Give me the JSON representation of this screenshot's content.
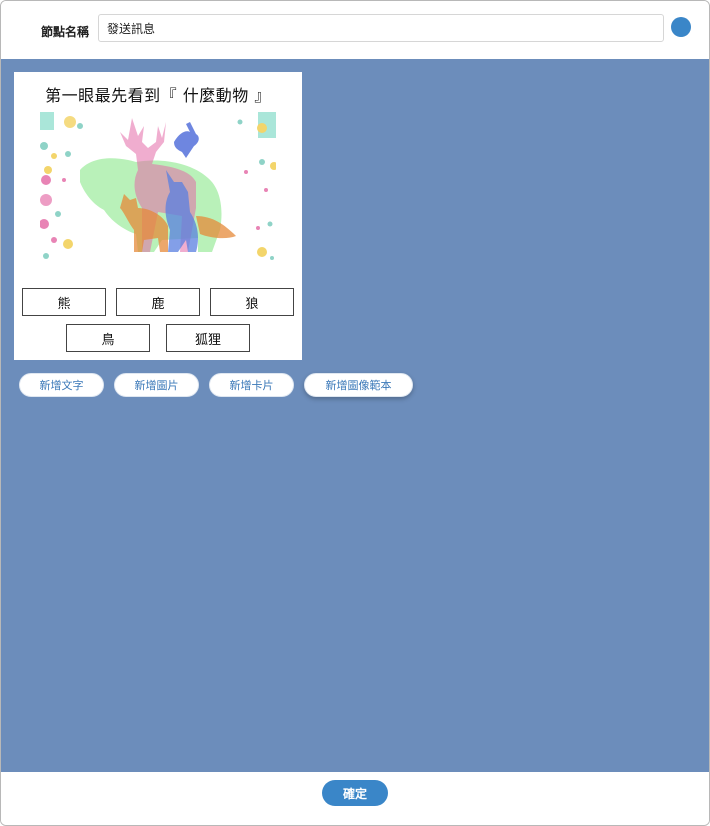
{
  "header": {
    "node_name_label": "節點名稱",
    "node_name_value": "發送訊息"
  },
  "card": {
    "title": "第一眼最先看到『 什麼動物 』",
    "image_icon": "animals-silhouette-image",
    "options": [
      "熊",
      "鹿",
      "狼",
      "鳥",
      "狐狸"
    ]
  },
  "actions": {
    "add_text": "新增文字",
    "add_image": "新增圖片",
    "add_card": "新增卡片",
    "add_image_template": "新增圖像範本"
  },
  "footer": {
    "confirm": "確定"
  },
  "colors": {
    "accent": "#3a86c8",
    "canvas_bg": "#6c8dbb",
    "button_text": "#3a78b8"
  }
}
